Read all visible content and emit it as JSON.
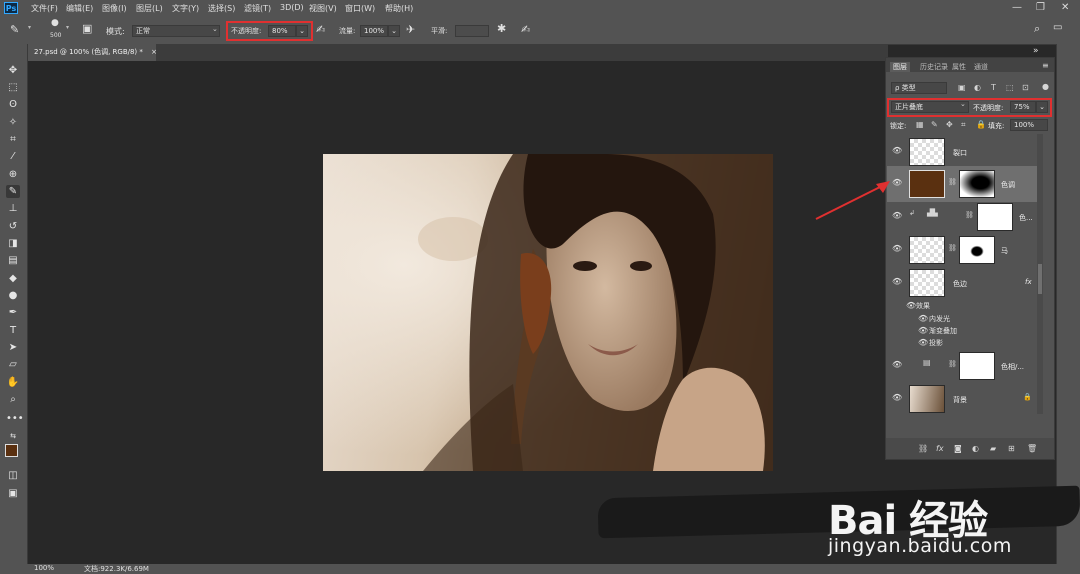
{
  "menubar": {
    "logo": "Ps",
    "items": [
      "文件(F)",
      "编辑(E)",
      "图像(I)",
      "图层(L)",
      "文字(Y)",
      "选择(S)",
      "滤镜(T)",
      "3D(D)",
      "视图(V)",
      "窗口(W)",
      "帮助(H)"
    ],
    "window_controls": [
      "—",
      "❐",
      "✕"
    ]
  },
  "options": {
    "brush_size": "500",
    "mode_label": "模式:",
    "mode_value": "正常",
    "opacity_label": "不透明度:",
    "opacity_value": "80%",
    "flow_label": "流量:",
    "flow_value": "100%",
    "smoothing_label": "平滑:"
  },
  "document": {
    "tab_label": "27.psd @ 100% (色调, RGB/8) *",
    "tab_close": "×"
  },
  "statusbar": {
    "zoom": "100%",
    "doc_info": "文档:922.3K/6.69M"
  },
  "layers_panel": {
    "tabs": [
      "图层",
      "历史记录",
      "属性",
      "通道"
    ],
    "kind_label": "ρ 类型",
    "blend_mode": "正片叠底",
    "opacity_label": "不透明度:",
    "opacity_value": "75%",
    "lock_label": "锁定:",
    "fill_label": "填充:",
    "fill_value": "100%",
    "layers": [
      {
        "name": "裂口"
      },
      {
        "name": "色调"
      },
      {
        "name": "色..."
      },
      {
        "name": "马"
      },
      {
        "name": "色边",
        "fx": "fx"
      },
      {
        "name": "色相/..."
      },
      {
        "name": "背景"
      }
    ],
    "effects_label": "效果",
    "effects": [
      "内发光",
      "渐变叠加",
      "投影"
    ],
    "bottom_icons": [
      "link-icon",
      "fx-icon",
      "mask-icon",
      "adjustment-icon",
      "group-icon",
      "new-layer-icon",
      "trash-icon"
    ]
  },
  "watermark": {
    "logo": "Bai 经验",
    "url": "jingyan.baidu.com"
  },
  "colors": {
    "highlight": "#e03030",
    "foreground": "#5a3010",
    "ps_blue": "#31a8ff"
  }
}
